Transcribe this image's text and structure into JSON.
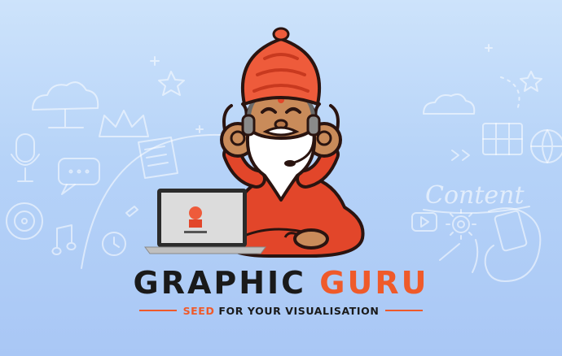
{
  "background": {
    "gradient_top": "#cde3fb",
    "gradient_bottom": "#a9c7f5",
    "doodle_word": "Content"
  },
  "brand": {
    "word1": "GRAPHIC",
    "word2": "GURU",
    "tagline_accent": "SEED",
    "tagline_rest": "FOR YOUR VISUALISATION"
  },
  "colors": {
    "accent": "#ef5a2a",
    "dark_text": "#1a1a1a",
    "turban": "#ee5b3b",
    "robe": "#e2462a",
    "skin": "#c98b5a",
    "beard": "#ffffff"
  },
  "icons": [
    "cloud-icon",
    "crown-icon",
    "star-icon",
    "microphone-icon",
    "chat-icon",
    "target-icon",
    "music-note-icon",
    "laptop-icon",
    "grid-icon",
    "globe-icon",
    "play-icon",
    "gear-icon",
    "headset-icon"
  ]
}
